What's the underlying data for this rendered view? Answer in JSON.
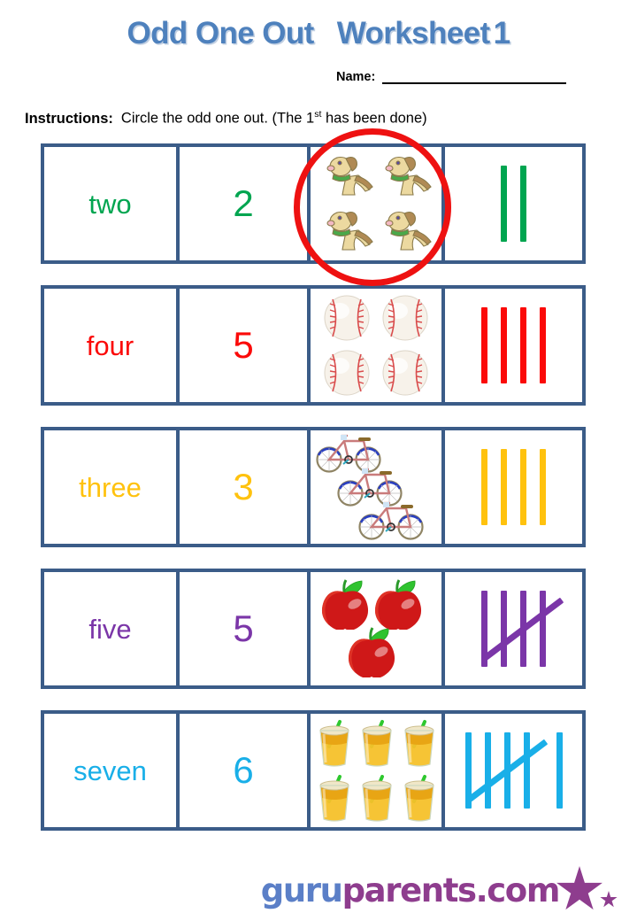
{
  "header": {
    "title_main": "Odd One Out",
    "title_sub": "Worksheet",
    "worksheet_number": "1",
    "name_label": "Name:",
    "name_value": "",
    "instructions_label": "Instructions:",
    "instructions_text_before": "Circle the odd one out. (The 1",
    "instructions_ordinal": "st",
    "instructions_text_after": " has been done)"
  },
  "colors": {
    "title_blue": "#4E81BD",
    "table_border": "#3B5C88",
    "answer_circle_red": "#EE1111",
    "row1_green": "#00A550",
    "row2_red": "#FB0A09",
    "row3_gold": "#FFC20E",
    "row4_purple": "#7B36A8",
    "row5_cyan": "#19AFE8",
    "logo_blue": "#5B7FC7",
    "logo_purple": "#8E3D8E"
  },
  "rows": [
    {
      "word": "two",
      "number": "2",
      "color": "#00A550",
      "picture": {
        "icon": "dog-icon",
        "count": 4,
        "layout": "grid2x2",
        "label": "dogs"
      },
      "tally": {
        "total": 2,
        "groups_of_five": 0,
        "remainder": 2
      },
      "circled_cell": "picture",
      "is_example": true
    },
    {
      "word": "four",
      "number": "5",
      "color": "#FB0A09",
      "picture": {
        "icon": "baseball-icon",
        "count": 4,
        "layout": "grid2x2",
        "label": "baseballs"
      },
      "tally": {
        "total": 4,
        "groups_of_five": 0,
        "remainder": 4
      },
      "circled_cell": null,
      "is_example": false
    },
    {
      "word": "three",
      "number": "3",
      "color": "#FFC20E",
      "picture": {
        "icon": "bicycle-icon",
        "count": 3,
        "layout": "diagonal",
        "label": "bicycles"
      },
      "tally": {
        "total": 4,
        "groups_of_five": 0,
        "remainder": 4
      },
      "circled_cell": null,
      "is_example": false
    },
    {
      "word": "five",
      "number": "5",
      "color": "#7B36A8",
      "picture": {
        "icon": "apple-icon",
        "count": 3,
        "layout": "triangle",
        "label": "apples"
      },
      "tally": {
        "total": 5,
        "groups_of_five": 1,
        "remainder": 0
      },
      "circled_cell": null,
      "is_example": false
    },
    {
      "word": "seven",
      "number": "6",
      "color": "#19AFE8",
      "picture": {
        "icon": "juice-glass-icon",
        "count": 6,
        "layout": "grid3x2",
        "label": "juice glasses"
      },
      "tally": {
        "total": 6,
        "groups_of_five": 1,
        "remainder": 1
      },
      "circled_cell": null,
      "is_example": false
    }
  ],
  "footer": {
    "logo_part1": "guru",
    "logo_part2": "parents.com"
  }
}
